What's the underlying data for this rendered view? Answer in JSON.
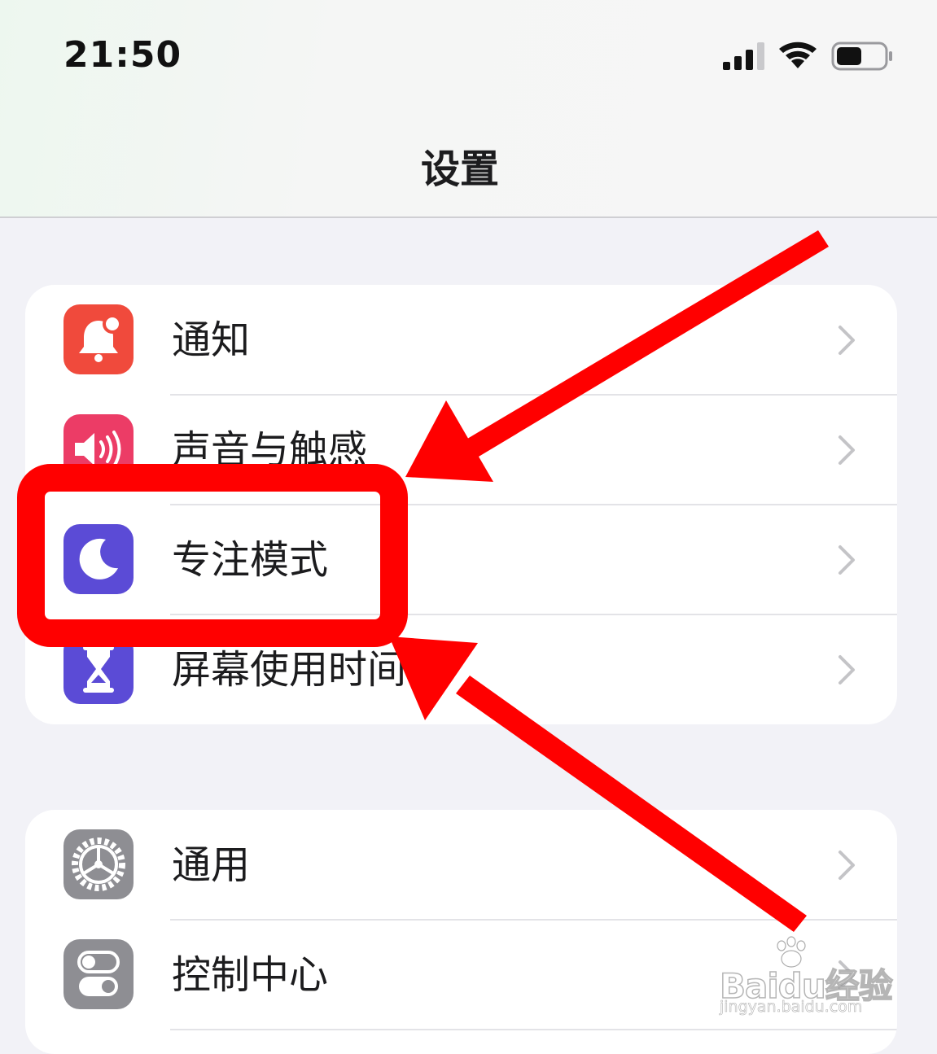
{
  "status_bar": {
    "time": "21:50",
    "icons": [
      "cellular-signal-icon",
      "wifi-icon",
      "battery-icon"
    ]
  },
  "nav": {
    "title": "设置"
  },
  "groups": [
    {
      "items": [
        {
          "label": "通知",
          "icon": "notification-bell-icon",
          "color": "#f04a3c"
        },
        {
          "label": "声音与触感",
          "icon": "speaker-icon",
          "color": "#ec3c66"
        },
        {
          "label": "专注模式",
          "icon": "moon-icon",
          "color": "#5b4bd6"
        },
        {
          "label": "屏幕使用时间",
          "icon": "hourglass-icon",
          "color": "#5b4bd6"
        }
      ]
    },
    {
      "items": [
        {
          "label": "通用",
          "icon": "gear-icon",
          "color": "#8e8e93"
        },
        {
          "label": "控制中心",
          "icon": "toggles-icon",
          "color": "#8e8e93"
        }
      ]
    }
  ],
  "annotation": {
    "color": "#ff0000",
    "highlighted_item": "专注模式"
  },
  "watermark": {
    "brand": "Baidu经验",
    "url": "jingyan.baidu.com"
  }
}
